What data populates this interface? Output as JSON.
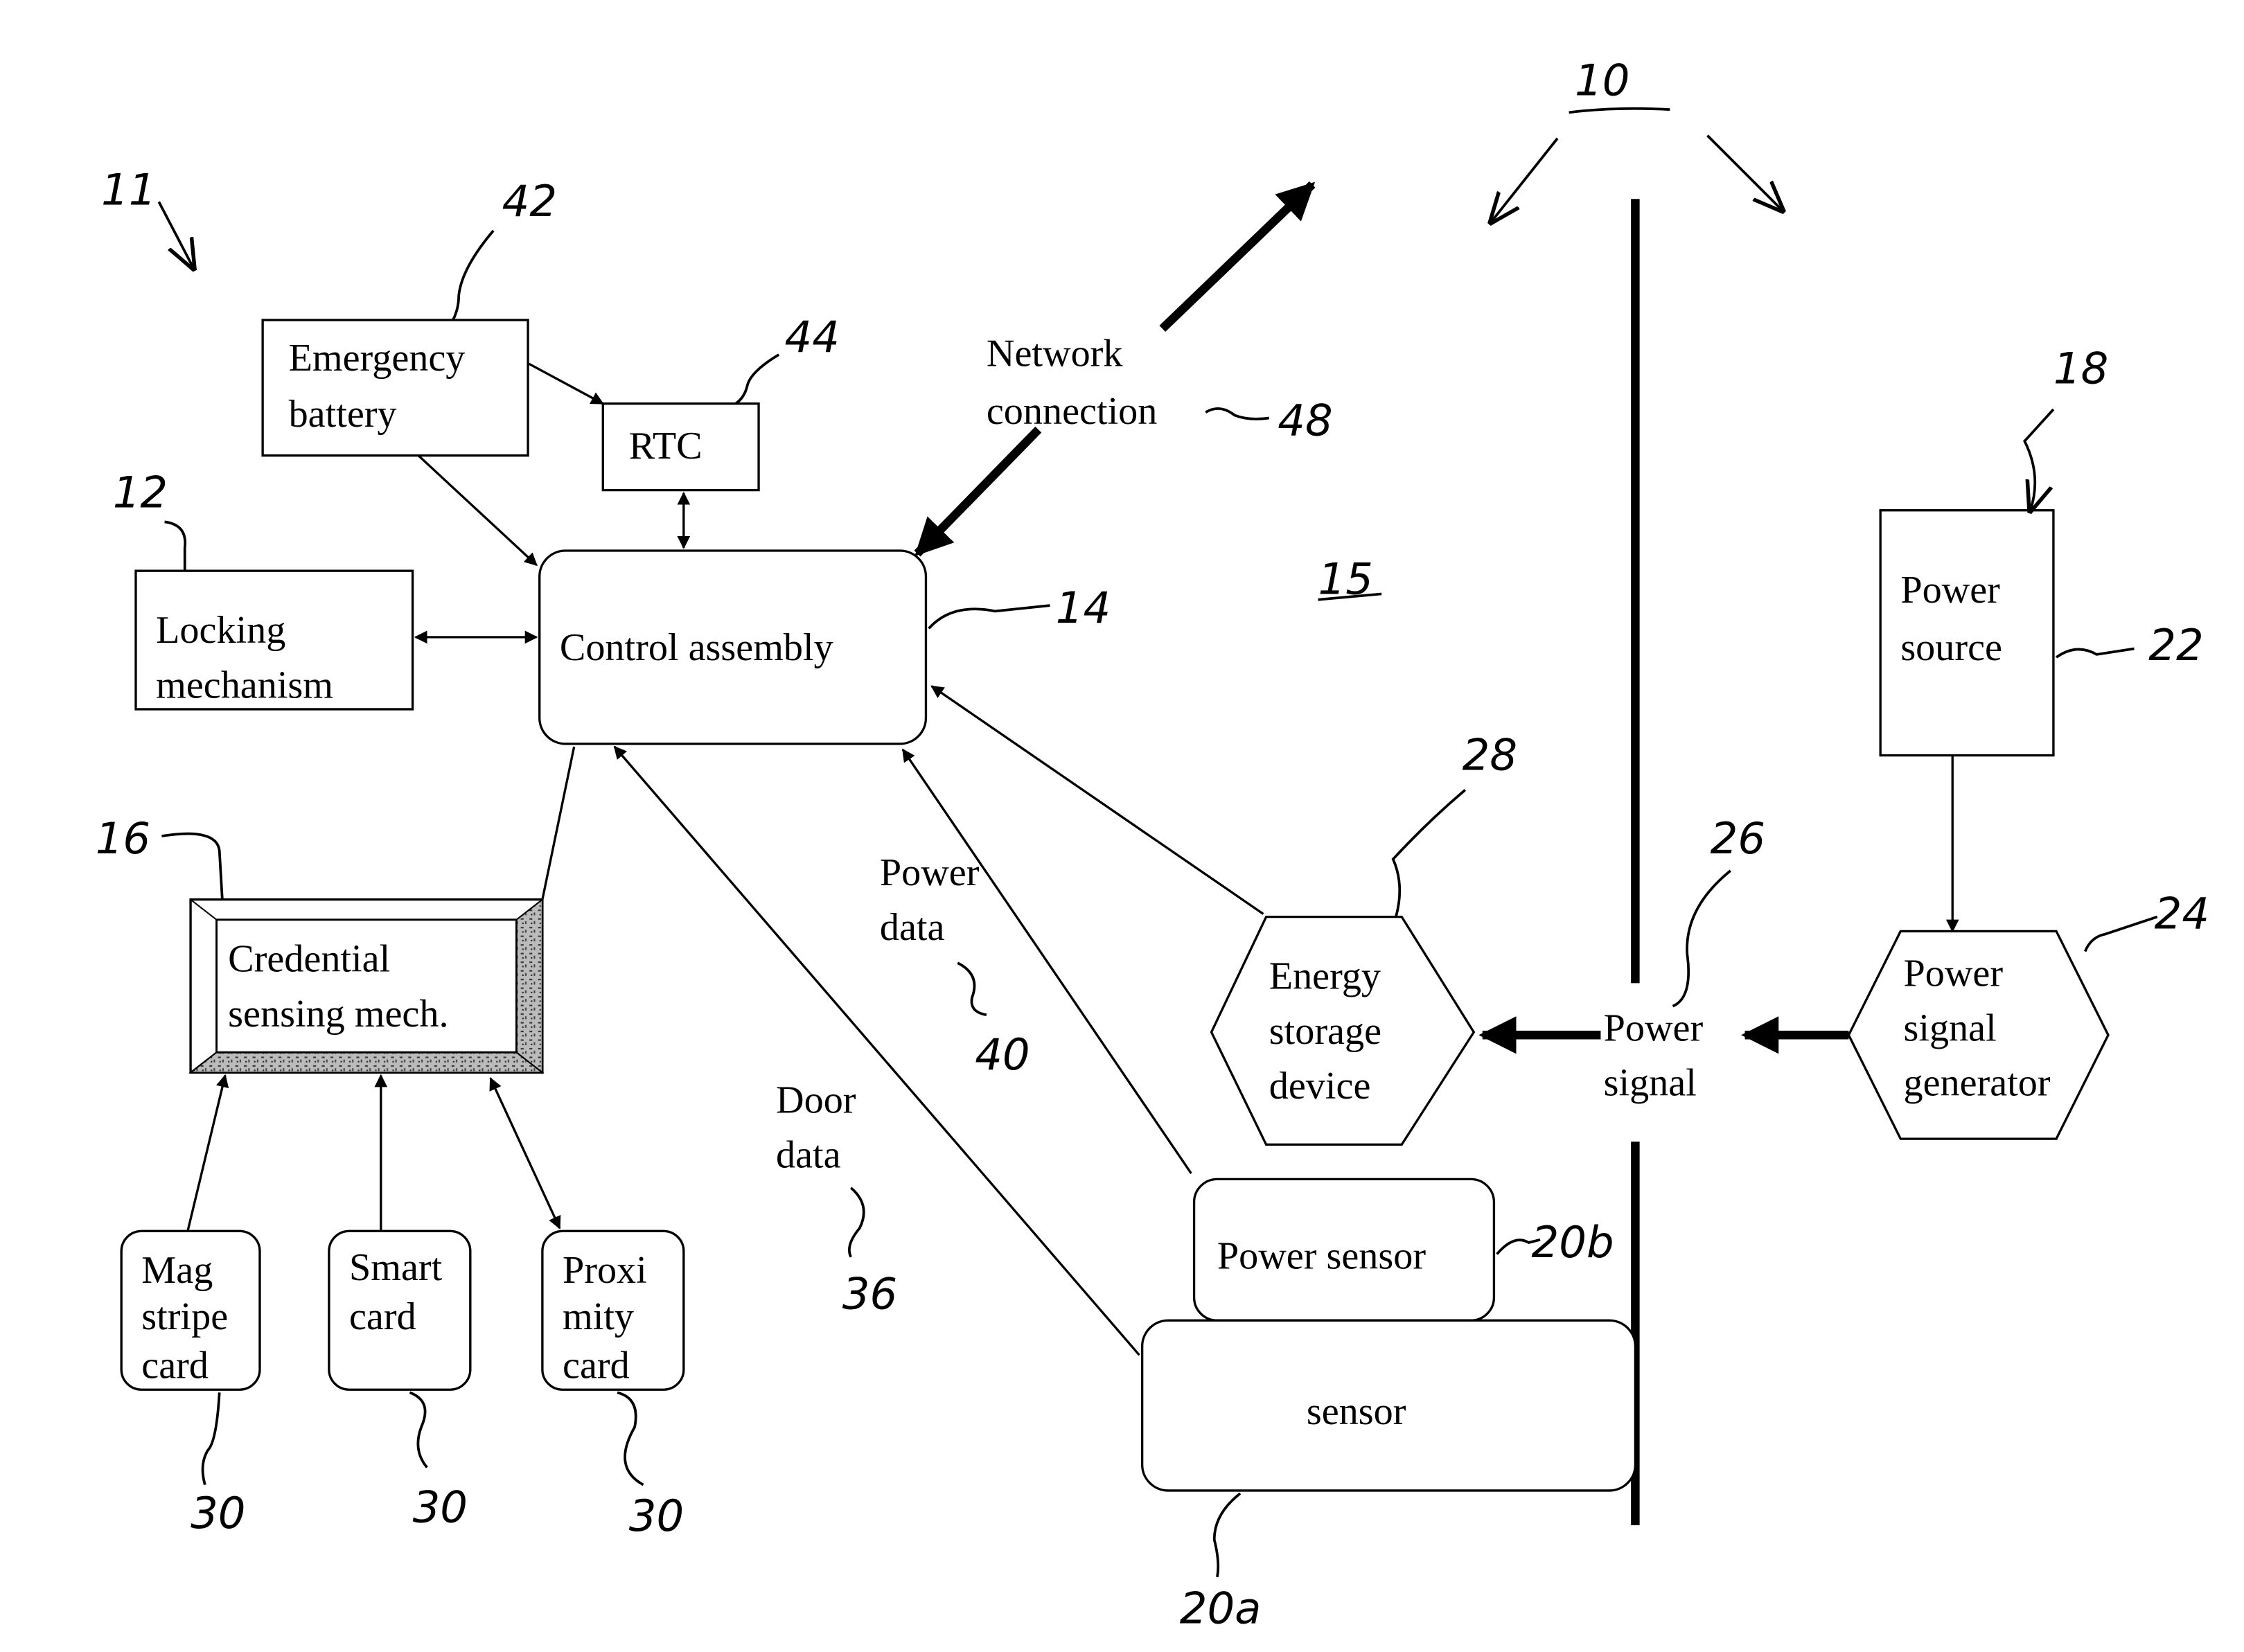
{
  "figure": {
    "system_ref": "10",
    "assembly_ref": "11",
    "region_ref": "15"
  },
  "blocks": {
    "emergency_battery": {
      "lines": [
        "Emergency",
        "battery"
      ],
      "ref": "42"
    },
    "rtc": {
      "lines": [
        "RTC"
      ],
      "ref": "44"
    },
    "locking_mechanism": {
      "lines": [
        "Locking",
        "mechanism"
      ],
      "ref": "12"
    },
    "control_assembly": {
      "lines": [
        "Control assembly"
      ],
      "ref": "14"
    },
    "credential_sensing": {
      "lines": [
        "Credential",
        "sensing mech."
      ],
      "ref": "16"
    },
    "mag_stripe_card": {
      "lines": [
        "Mag",
        "stripe",
        "card"
      ],
      "ref": "30"
    },
    "smart_card": {
      "lines": [
        "Smart",
        "card"
      ],
      "ref": "30"
    },
    "proximity_card": {
      "lines": [
        "Proxi",
        "mity",
        "card"
      ],
      "ref": "30"
    },
    "power_source": {
      "lines": [
        "Power",
        "source"
      ],
      "ref": "22",
      "group_ref": "18"
    },
    "power_signal_generator": {
      "lines": [
        "Power",
        "signal",
        "generator"
      ],
      "ref": "24"
    },
    "energy_storage_device": {
      "lines": [
        "Energy",
        "storage",
        "device"
      ],
      "ref": "28"
    },
    "power_sensor": {
      "lines": [
        "Power sensor"
      ],
      "ref": "20b"
    },
    "sensor": {
      "lines": [
        "sensor"
      ],
      "ref": "20a"
    }
  },
  "labels": {
    "network_connection": {
      "lines": [
        "Network",
        "connection"
      ],
      "ref": "48"
    },
    "power_signal": {
      "lines": [
        "Power",
        "signal"
      ],
      "ref": "26"
    },
    "power_data": {
      "lines": [
        "Power",
        "data"
      ],
      "ref": "40"
    },
    "door_data": {
      "lines": [
        "Door",
        "data"
      ],
      "ref": "36"
    }
  }
}
